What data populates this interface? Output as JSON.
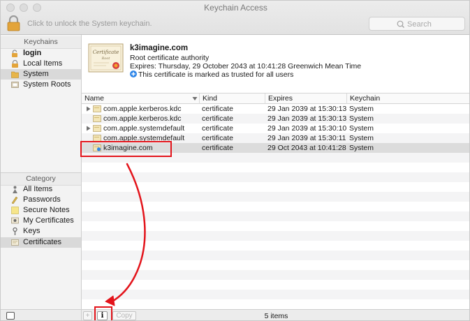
{
  "window": {
    "title": "Keychain Access",
    "unlock_text": "Click to unlock the System keychain.",
    "search_placeholder": "Search"
  },
  "sidebar": {
    "keychains_header": "Keychains",
    "keychains": [
      {
        "label": "login",
        "icon": "lock-open-icon",
        "bold": true
      },
      {
        "label": "Local Items",
        "icon": "lock-icon"
      },
      {
        "label": "System",
        "icon": "folder-icon",
        "selected": true
      },
      {
        "label": "System Roots",
        "icon": "roots-folder-icon"
      }
    ],
    "category_header": "Category",
    "categories": [
      {
        "label": "All Items",
        "icon": "people-icon"
      },
      {
        "label": "Passwords",
        "icon": "key-pen-icon"
      },
      {
        "label": "Secure Notes",
        "icon": "note-icon"
      },
      {
        "label": "My Certificates",
        "icon": "my-cert-icon"
      },
      {
        "label": "Keys",
        "icon": "key-icon"
      },
      {
        "label": "Certificates",
        "icon": "certificate-icon",
        "selected": true
      }
    ]
  },
  "detail": {
    "name": "k3imagine.com",
    "type": "Root certificate authority",
    "expires": "Expires: Thursday, 29 October 2043 at 10:41:28 Greenwich Mean Time",
    "trust": "This certificate is marked as trusted for all users",
    "image_script": "Certificate",
    "image_sub": "Root"
  },
  "table": {
    "columns": [
      "Name",
      "Kind",
      "Expires",
      "Keychain"
    ],
    "rows": [
      {
        "name": "com.apple.kerberos.kdc",
        "kind": "certificate",
        "expires": "29 Jan 2039 at 15:30:13",
        "keychain": "System",
        "expandable": true
      },
      {
        "name": "com.apple.kerberos.kdc",
        "kind": "certificate",
        "expires": "29 Jan 2039 at 15:30:13",
        "keychain": "System",
        "expandable": false
      },
      {
        "name": "com.apple.systemdefault",
        "kind": "certificate",
        "expires": "29 Jan 2039 at 15:30:10",
        "keychain": "System",
        "expandable": true
      },
      {
        "name": "com.apple.systemdefault",
        "kind": "certificate",
        "expires": "29 Jan 2039 at 15:30:11",
        "keychain": "System",
        "expandable": false
      },
      {
        "name": "k3imagine.com",
        "kind": "certificate",
        "expires": "29 Oct 2043 at 10:41:28",
        "keychain": "System",
        "expandable": false,
        "selected": true,
        "trusted_root": true
      }
    ]
  },
  "bottom": {
    "add_label": "+",
    "info_label": "i",
    "copy_label": "Copy",
    "count": "5 items"
  },
  "colors": {
    "annotation": "#e3141b",
    "selection": "#dcdcdc",
    "trust_badge": "#2f86e8"
  }
}
